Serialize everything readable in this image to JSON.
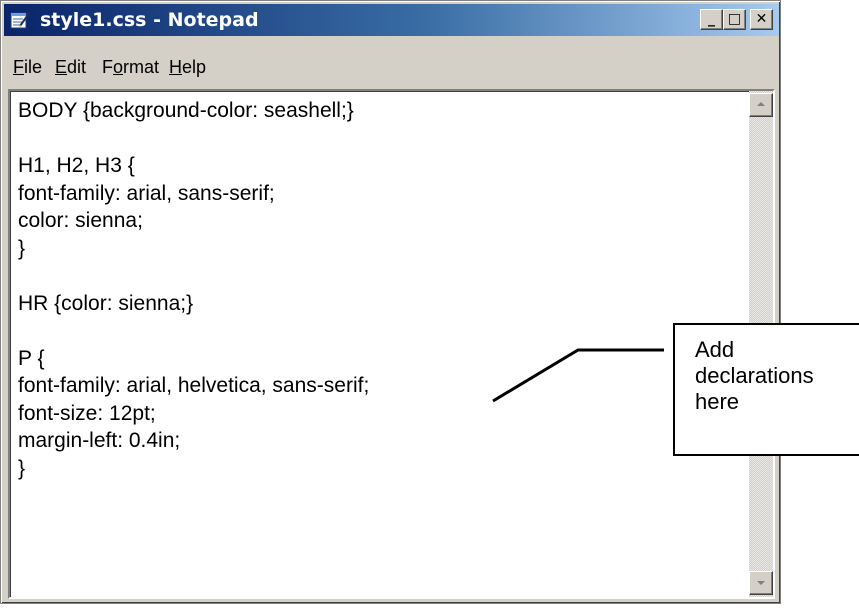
{
  "window": {
    "title": "style1.css - Notepad",
    "buttons": {
      "minimize": "_",
      "maximize": "□",
      "close": "✕"
    }
  },
  "menu": {
    "items": [
      {
        "label": "File"
      },
      {
        "label": "Edit"
      },
      {
        "label": "Format"
      },
      {
        "label": "Help"
      }
    ]
  },
  "editor": {
    "content": "BODY {background-color: seashell;}\n\nH1, H2, H3 {\nfont-family: arial, sans-serif;\ncolor: sienna;\n}\n\nHR {color: sienna;}\n\nP {\nfont-family: arial, helvetica, sans-serif;\nfont-size: 12pt;\nmargin-left: 0.4in;\n}"
  },
  "annotation": {
    "text": "Add\ndeclarations\nhere"
  },
  "colors": {
    "titlebar_start": "#0a246a",
    "titlebar_end": "#a6caf0",
    "chrome": "#d4d0c8"
  },
  "icons": {
    "app": "notepad-icon",
    "scroll_up": "scroll-up-arrow-icon",
    "scroll_down": "scroll-down-arrow-icon"
  }
}
